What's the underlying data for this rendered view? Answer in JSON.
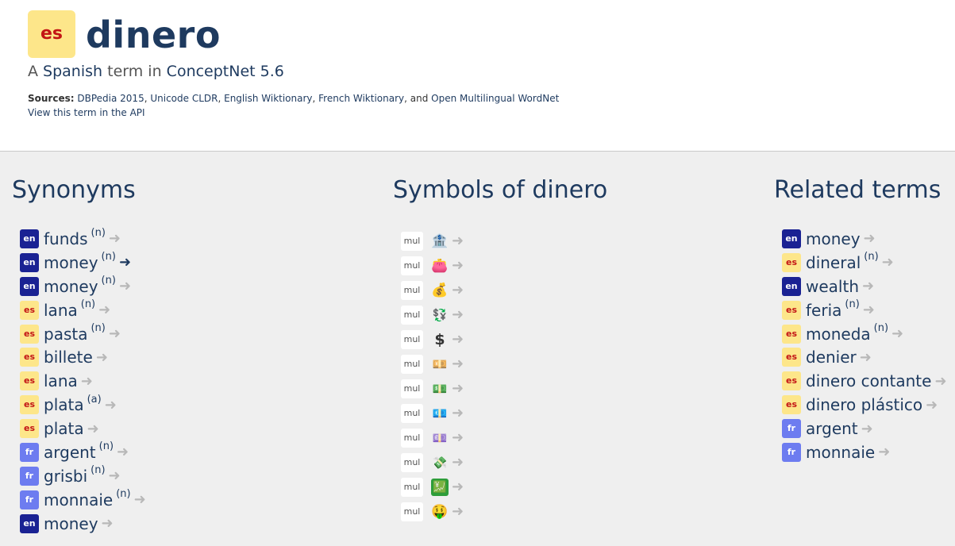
{
  "header": {
    "lang_code": "es",
    "term": "dinero",
    "subtitle_prefix": "A",
    "language": "Spanish",
    "subtitle_mid": "term in",
    "source_project": "ConceptNet 5.6",
    "sources_label": "Sources:",
    "sources": [
      "DBPedia 2015",
      "Unicode CLDR",
      "English Wiktionary",
      "French Wiktionary",
      "Open Multilingual WordNet"
    ],
    "sources_and": "and",
    "api_link": "View this term in the API"
  },
  "synonyms": {
    "title": "Synonyms",
    "items": [
      {
        "lang": "en",
        "term": "funds",
        "pos": "(n)",
        "arrow": "➜"
      },
      {
        "lang": "en",
        "term": "money",
        "pos": "(n)",
        "arrow": "➜"
      },
      {
        "lang": "en",
        "term": "money",
        "pos": "(n)",
        "arrow": "➜"
      },
      {
        "lang": "es",
        "term": "lana",
        "pos": "(n)",
        "arrow": "➜"
      },
      {
        "lang": "es",
        "term": "pasta",
        "pos": "(n)",
        "arrow": "➜"
      },
      {
        "lang": "es",
        "term": "billete",
        "pos": "",
        "arrow": "➜"
      },
      {
        "lang": "es",
        "term": "lana",
        "pos": "",
        "arrow": "➜"
      },
      {
        "lang": "es",
        "term": "plata",
        "pos": "(a)",
        "arrow": "➜"
      },
      {
        "lang": "es",
        "term": "plata",
        "pos": "",
        "arrow": "➜"
      },
      {
        "lang": "fr",
        "term": "argent",
        "pos": "(n)",
        "arrow": "➜"
      },
      {
        "lang": "fr",
        "term": "grisbi",
        "pos": "(n)",
        "arrow": "➜"
      },
      {
        "lang": "fr",
        "term": "monnaie",
        "pos": "(n)",
        "arrow": "➜"
      },
      {
        "lang": "en",
        "term": "money",
        "pos": "",
        "arrow": "➜"
      }
    ]
  },
  "symbols": {
    "title": "Symbols of dinero",
    "items": [
      {
        "lang": "mul",
        "glyph": "🏦",
        "icon": "bank-icon",
        "arrow": "➜"
      },
      {
        "lang": "mul",
        "glyph": "👛",
        "icon": "purse-icon",
        "arrow": "➜"
      },
      {
        "lang": "mul",
        "glyph": "💰",
        "icon": "money-bag-icon",
        "arrow": "➜"
      },
      {
        "lang": "mul",
        "glyph": "💱",
        "icon": "currency-exchange-icon",
        "arrow": "➜"
      },
      {
        "lang": "mul",
        "glyph": "$",
        "icon": "dollar-sign-icon",
        "arrow": "➜"
      },
      {
        "lang": "mul",
        "glyph": "💴",
        "icon": "yen-banknote-icon",
        "arrow": "➜"
      },
      {
        "lang": "mul",
        "glyph": "💵",
        "icon": "dollar-banknote-icon",
        "arrow": "➜"
      },
      {
        "lang": "mul",
        "glyph": "💶",
        "icon": "euro-banknote-icon",
        "arrow": "➜"
      },
      {
        "lang": "mul",
        "glyph": "💷",
        "icon": "pound-banknote-icon",
        "arrow": "➜"
      },
      {
        "lang": "mul",
        "glyph": "💸",
        "icon": "money-with-wings-icon",
        "arrow": "➜"
      },
      {
        "lang": "mul",
        "glyph": "💹",
        "icon": "chart-increasing-yen-icon",
        "arrow": "➜"
      },
      {
        "lang": "mul",
        "glyph": "🤑",
        "icon": "money-mouth-face-icon",
        "arrow": "➜"
      }
    ]
  },
  "related": {
    "title": "Related terms",
    "items": [
      {
        "lang": "en",
        "term": "money",
        "pos": "",
        "arrow": "➜"
      },
      {
        "lang": "es",
        "term": "dineral",
        "pos": "(n)",
        "arrow": "➜"
      },
      {
        "lang": "en",
        "term": "wealth",
        "pos": "",
        "arrow": "➜"
      },
      {
        "lang": "es",
        "term": "feria",
        "pos": "(n)",
        "arrow": "➜"
      },
      {
        "lang": "es",
        "term": "moneda",
        "pos": "(n)",
        "arrow": "➜"
      },
      {
        "lang": "es",
        "term": "denier",
        "pos": "",
        "arrow": "➜"
      },
      {
        "lang": "es",
        "term": "dinero contante",
        "pos": "",
        "arrow": "➜"
      },
      {
        "lang": "es",
        "term": "dinero plástico",
        "pos": "",
        "arrow": "➜"
      },
      {
        "lang": "fr",
        "term": "argent",
        "pos": "",
        "arrow": "➜"
      },
      {
        "lang": "fr",
        "term": "monnaie",
        "pos": "",
        "arrow": "➜"
      }
    ]
  },
  "colors": {
    "title": "#1e3a5f",
    "en_badge": "#1a2293",
    "es_badge": "#fde68a",
    "fr_badge": "#6d7cf0",
    "arrow": "#b8b8b8"
  }
}
